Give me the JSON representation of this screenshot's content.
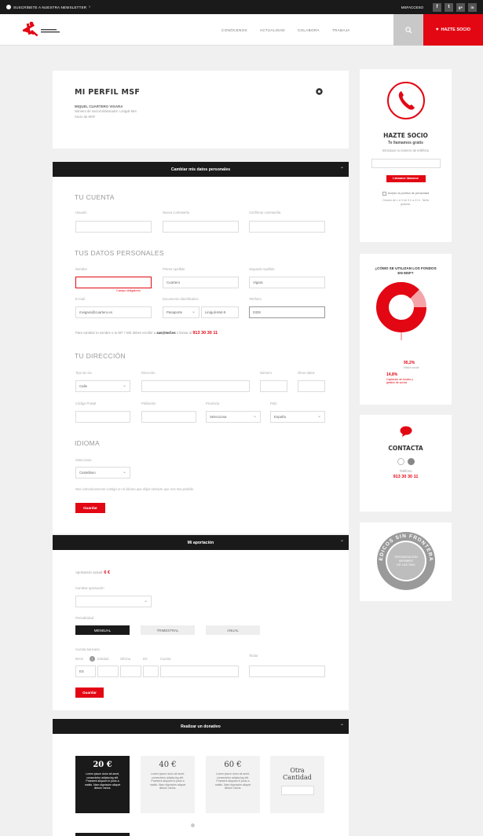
{
  "topbar": {
    "newsletter": "SUSCRÍBETE A NUESTRA NEWSLETTER",
    "account": "MSFACCESO",
    "social": [
      "f",
      "t",
      "g+",
      "in"
    ]
  },
  "header": {
    "nav": [
      "CONÓCENOS",
      "ACTUALIDAD",
      "COLABORA",
      "TRABAJA"
    ],
    "search_icon": "search-icon",
    "cta": "HAZTE SOCIO"
  },
  "profile": {
    "title": "MI PERFIL MSF",
    "name": "MIQUEL CUARTERO VIGARA",
    "line1": "Número de socio/colaborador: Liniguli-Mot",
    "line2": "Socio de MSF"
  },
  "sections": {
    "personal": "Cambiar mis datos personales",
    "aportacion": "Mi aportación",
    "donativo": "Realizar un donativo"
  },
  "account": {
    "title": "TU CUENTA",
    "labels": [
      "Usuario",
      "Nueva contraseña",
      "Confirmar contraseña"
    ]
  },
  "personal": {
    "title": "TUS DATOS PERSONALES",
    "labels": {
      "nombre": "Nombre",
      "apellido1": "Primer Apellido",
      "apellido2": "Segundo Apellido",
      "email": "E-mail",
      "doc": "Documento identificativo",
      "tel": "Teléfono"
    },
    "values": {
      "apellido1": "Cuartero",
      "apellido2": "Vigara",
      "email": "mvigara@cuartero.es",
      "doc_type": "Pasaporte",
      "doc_num": "Liniguli-Mot-9",
      "tel": "0328"
    },
    "error": "Campo obligatorio",
    "note": "Para cambiar tu nombre o tu NIF / NIE debes escribir a",
    "note_email": "sas@msf.es",
    "note_mid": "o llamar al",
    "phone": "913 30 30 11"
  },
  "address": {
    "title": "TU DIRECCIÓN",
    "labels": {
      "via": "Tipo de vía",
      "dir": "Dirección",
      "num": "Número",
      "otros": "Otros datos",
      "cp": "Código Postal",
      "pob": "Población",
      "prov": "Provincia",
      "pais": "País"
    },
    "values": {
      "via": "Calle",
      "prov": "Selecciona",
      "pais": "España"
    }
  },
  "language": {
    "title": "IDIOMA",
    "label": "Selecciona",
    "value": "Castellano",
    "note": "Nos comunicaremos contigo en el idioma que elijas siempre que nos sea posible.",
    "save": "Guardar"
  },
  "aportacion": {
    "current_label": "Aportación actual:",
    "current_value": "6 €",
    "change_label": "Cambiar aportación",
    "freq_label": "Periodicidad",
    "freq": [
      "MENSUAL",
      "TRIMESTRAL",
      "ANUAL"
    ],
    "bank_label": "Cuenta bancaria",
    "bank_fields": [
      "IBAN",
      "Entidad",
      "Oficina",
      "DC",
      "Cuenta"
    ],
    "iban_value": "ES",
    "holder_label": "Titular",
    "save": "Guardar"
  },
  "donativo": {
    "options": [
      {
        "amount": "20 €",
        "text": "Lorem ipsum dolor sit amet, consectetur adipiscing elit. Praesent aliquam in justo a mattis. Nam dignissim aliquet dictum varius."
      },
      {
        "amount": "40 €",
        "text": "Lorem ipsum dolor sit amet, consectetur adipiscing elit. Praesent aliquam in justo a mattis. Nam dignissim aliquet dictum varius."
      },
      {
        "amount": "60 €",
        "text": "Lorem ipsum dolor sit amet, consectetur adipiscing elit. Praesent aliquam in justo a mattis. Nam dignissim aliquet dictum varius."
      }
    ],
    "other": "Otra Cantidad"
  },
  "sidebar": {
    "socio": {
      "title": "HAZTE SOCIO",
      "subtitle": "Te llamamos gratis",
      "desc": "Introduce tu número de teléfono",
      "btn": "Llámame llámame",
      "check": "Acepto la política de privacidad",
      "hint": "Horario de L a V de 9 h a 21 h. Tarifa gratuita."
    },
    "fondos": {
      "title": "¿CÓMO SE UTILIZAN LOS FONDOS EN MSF?",
      "pct1": "95,2%",
      "pct1_label": "Misión social",
      "pct2": "14,8%",
      "pct2_label": "Captación de fondos y gestión de socios"
    },
    "contacta": {
      "title": "CONTACTA",
      "tel_label": "Teléfono",
      "tel": "913 30 30 11"
    },
    "seal": {
      "ring": "MEDICOS SIN FRONTERAS",
      "inner": "ORGANIZACIÓN MIEMBRO DE LAS ONG",
      "color": "#9a9a9a"
    }
  },
  "colors": {
    "red": "#e30613",
    "dark": "#1a1a1a"
  }
}
